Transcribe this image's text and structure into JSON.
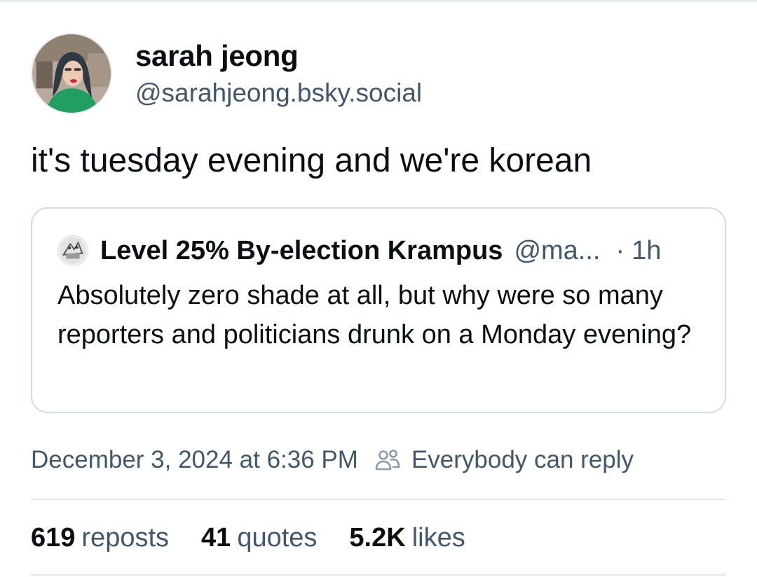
{
  "author": {
    "display_name": "sarah jeong",
    "handle": "@sarahjeong.bsky.social",
    "avatar_icon": "user-avatar-photo"
  },
  "post": {
    "text": "it's tuesday evening and we're korean"
  },
  "quoted_post": {
    "display_name": "Level 25% By-election Krampus",
    "handle": "@ma...",
    "separator": "·",
    "time": "1h",
    "text": "Absolutely zero shade at all, but why were so many reporters and politicians drunk on a Monday evening?",
    "avatar_icon": "user-avatar-sketch"
  },
  "meta": {
    "timestamp": "December 3, 2024 at 6:36 PM",
    "reply_icon": "people-icon",
    "reply_setting": "Everybody can reply"
  },
  "stats": {
    "reposts_count": "619",
    "reposts_label": "reposts",
    "quotes_count": "41",
    "quotes_label": "quotes",
    "likes_count": "5.2K",
    "likes_label": "likes"
  },
  "colors": {
    "text": "#0b0f14",
    "secondary_text": "#42576c",
    "border": "#d4dbe2"
  }
}
